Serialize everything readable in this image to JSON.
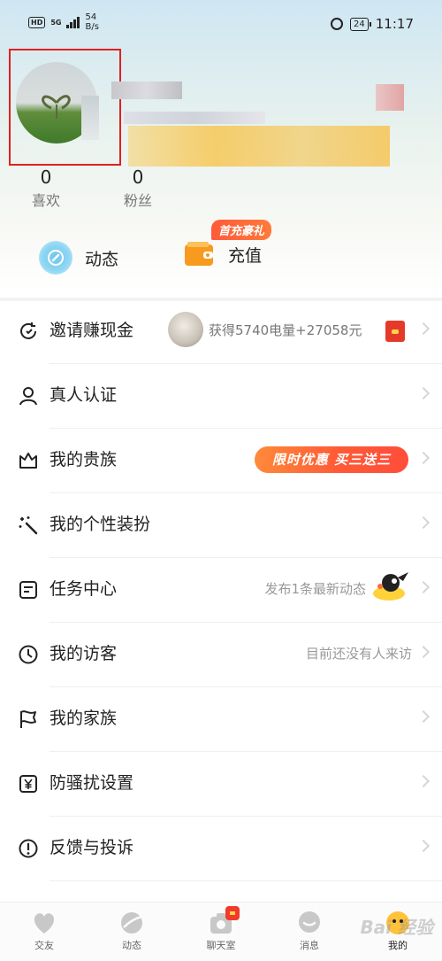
{
  "status_bar": {
    "hd_label": "HD",
    "network_label": "5G",
    "speed_value": "54",
    "speed_unit": "B/s",
    "battery": "24",
    "time": "11:17"
  },
  "profile": {
    "stats": [
      {
        "value": "0",
        "label": "喜欢"
      },
      {
        "value": "0",
        "label": "粉丝"
      }
    ]
  },
  "quick_actions": {
    "moments_label": "动态",
    "recharge_label": "充值",
    "first_recharge_badge": "首充豪礼"
  },
  "menu": {
    "invite": {
      "title": "邀请赚现金",
      "reward_text": "获得5740电量+27058元"
    },
    "verify": {
      "title": "真人认证"
    },
    "nobility": {
      "title": "我的贵族",
      "promo": "限时优惠  买三送三"
    },
    "dress": {
      "title": "我的个性装扮"
    },
    "tasks": {
      "title": "任务中心",
      "hint": "发布1条最新动态"
    },
    "visitors": {
      "title": "我的访客",
      "hint": "目前还没有人来访"
    },
    "family": {
      "title": "我的家族"
    },
    "antiharass": {
      "title": "防骚扰设置"
    },
    "feedback": {
      "title": "反馈与投诉"
    }
  },
  "bottom_nav": {
    "tabs": [
      {
        "label": "交友"
      },
      {
        "label": "动态"
      },
      {
        "label": "聊天室"
      },
      {
        "label": "消息"
      },
      {
        "label": "我的"
      }
    ]
  },
  "watermark": "Bai 经验",
  "colors": {
    "accent_orange": "#ff5a36",
    "highlight_red": "#e02020",
    "moments_blue": "#6cc7ee",
    "wallet_orange": "#f79a1e"
  }
}
